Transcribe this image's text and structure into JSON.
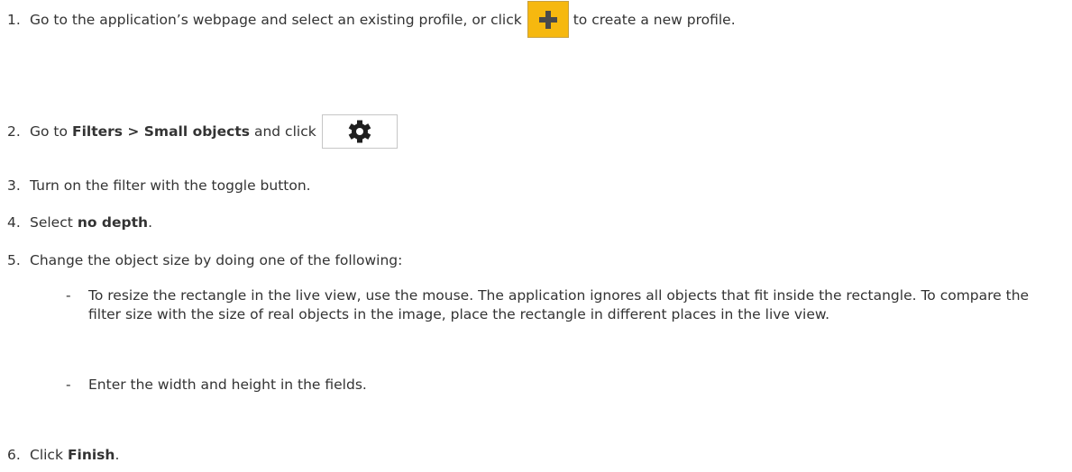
{
  "steps": {
    "s1": {
      "num": "1.",
      "text_before": "Go to the application’s webpage and select an existing profile, or click",
      "text_after": "to create a new profile.",
      "icon": "plus-icon"
    },
    "s2": {
      "num": "2.",
      "text_before": "Go to",
      "bold": "Filters > Small objects",
      "text_after": "and click",
      "icon": "gear-icon"
    },
    "s3": {
      "num": "3.",
      "text": "Turn on the filter with the toggle button."
    },
    "s4": {
      "num": "4.",
      "text_before": "Select",
      "bold": "no depth",
      "text_after": "."
    },
    "s5": {
      "num": "5.",
      "text": "Change the object size by doing one of the following:",
      "subitems": [
        {
          "dash": "-",
          "text": "To resize the rectangle in the live view, use the mouse. The application ignores all objects that fit inside the rectangle. To compare the filter size with the size of real objects in the image, place the rectangle in different places in the live view."
        },
        {
          "dash": "-",
          "text": "Enter the width and height in the fields."
        }
      ]
    },
    "s6": {
      "num": "6.",
      "text_before": "Click",
      "bold": "Finish",
      "text_after": "."
    }
  },
  "colors": {
    "plus_button": "#f6b80f",
    "plus_glyph": "#4a4a4a",
    "gear_glyph": "#1f1f1f",
    "text": "#333333"
  }
}
